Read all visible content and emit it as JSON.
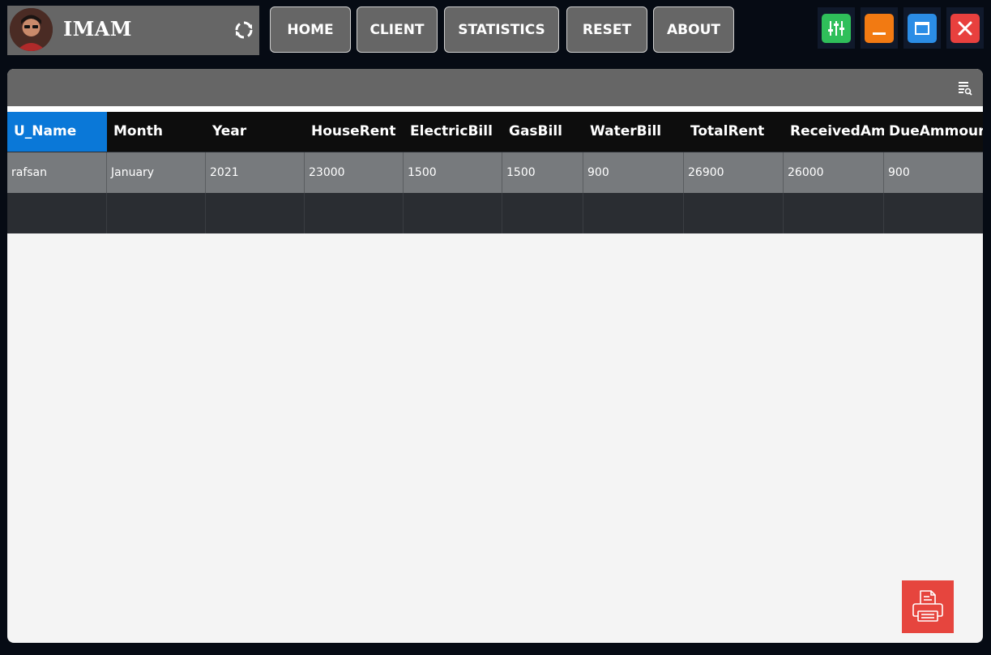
{
  "header": {
    "user_name": "IMAM",
    "nav": [
      "HOME",
      "CLIENT",
      "STATISTICS",
      "RESET",
      "ABOUT"
    ]
  },
  "window_controls": {
    "settings": {
      "icon": "sliders-icon",
      "color": "#2fbf5a"
    },
    "minimize": {
      "icon": "minimize-icon",
      "color": "#f27a12"
    },
    "maximize": {
      "icon": "maximize-icon",
      "color": "#2b8de6"
    },
    "close": {
      "icon": "close-icon",
      "color": "#e8403e"
    }
  },
  "table": {
    "columns": [
      "U_Name",
      "Month",
      "Year",
      "HouseRent",
      "ElectricBill",
      "GasBill",
      "WaterBill",
      "TotalRent",
      "ReceivedAm",
      "DueAmmour"
    ],
    "selected_column": "U_Name",
    "rows": [
      [
        "rafsan",
        "January",
        "2021",
        "23000",
        "1500",
        "1500",
        "900",
        "26900",
        "26000",
        "900"
      ]
    ]
  },
  "colors": {
    "accent": "#0a78d8",
    "print": "#e6453e"
  }
}
